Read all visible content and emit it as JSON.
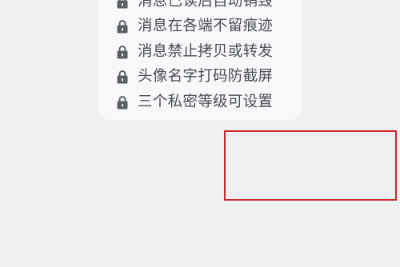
{
  "privacy_features": {
    "items": [
      {
        "label": "消息已读后自动销毁",
        "icon": "lock-icon"
      },
      {
        "label": "消息在各端不留痕迹",
        "icon": "lock-icon"
      },
      {
        "label": "消息禁止拷贝或转发",
        "icon": "lock-icon"
      },
      {
        "label": "头像名字打码防截屏",
        "icon": "lock-icon"
      },
      {
        "label": "三个私密等级可设置",
        "icon": "lock-icon"
      }
    ]
  },
  "colors": {
    "background": "#eef0f2",
    "card": "#f7f8f9",
    "icon": "#5b5e63",
    "text": "#4a4d52",
    "highlight": "#cc2a2a"
  }
}
